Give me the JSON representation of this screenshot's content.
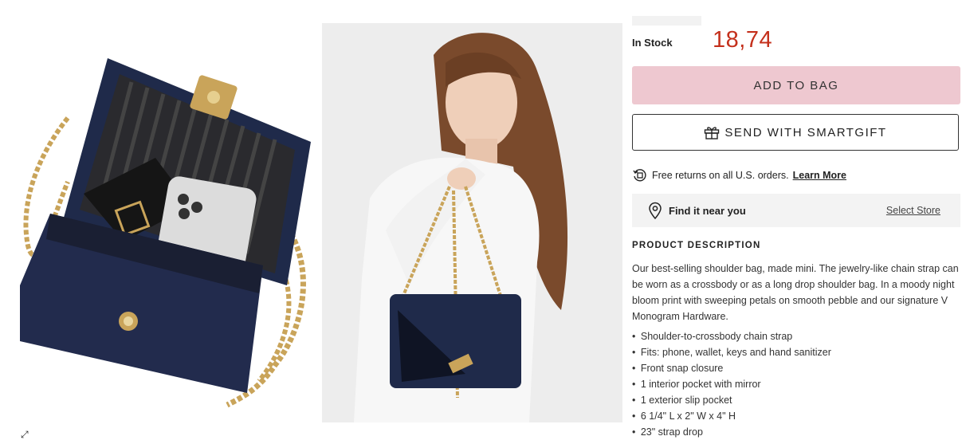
{
  "product": {
    "stock": "In Stock",
    "price": "18,74"
  },
  "buttons": {
    "add_to_bag": "ADD TO BAG",
    "smartgift": "SEND WITH SMARTGIFT"
  },
  "returns": {
    "text": "Free returns on all U.S. orders.",
    "link": "Learn More"
  },
  "store": {
    "label": "Find it near you",
    "link": "Select Store"
  },
  "description": {
    "heading": "PRODUCT DESCRIPTION",
    "body": "Our best-selling shoulder bag, made mini. The jewelry-like chain strap can be worn as a crossbody or as a long drop shoulder bag. In a moody night bloom print with sweeping petals on smooth pebble and our signature V Monogram Hardware.",
    "bullets": [
      "Shoulder-to-crossbody chain strap",
      "Fits: phone, wallet, keys and hand sanitizer",
      "Front snap closure",
      "1 interior pocket with mirror",
      "1 exterior slip pocket",
      "6 1/4\" L x 2\" W x 4\" H",
      "23\" strap drop"
    ]
  },
  "colors": {
    "price": "#c4301c",
    "add_to_bag_bg": "#eec8d0",
    "bag_navy": "#1f2a4a"
  },
  "icons": {
    "gift": "gift-icon",
    "returns": "returns-icon",
    "pin": "location-pin-icon",
    "expand": "expand-icon"
  }
}
